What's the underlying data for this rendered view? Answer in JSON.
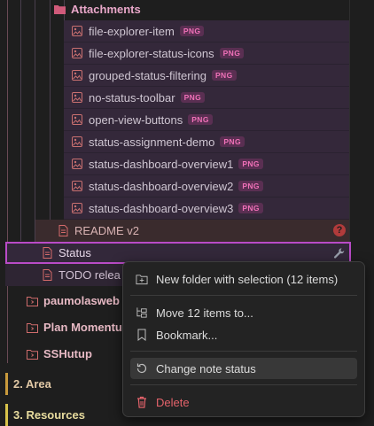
{
  "tree": {
    "attachments_folder": "Attachments",
    "files": [
      {
        "name": "file-explorer-item",
        "ext": "PNG"
      },
      {
        "name": "file-explorer-status-icons",
        "ext": "PNG"
      },
      {
        "name": "grouped-status-filtering",
        "ext": "PNG"
      },
      {
        "name": "no-status-toolbar",
        "ext": "PNG"
      },
      {
        "name": "open-view-buttons",
        "ext": "PNG"
      },
      {
        "name": "status-assignment-demo",
        "ext": "PNG"
      },
      {
        "name": "status-dashboard-overview1",
        "ext": "PNG"
      },
      {
        "name": "status-dashboard-overview2",
        "ext": "PNG"
      },
      {
        "name": "status-dashboard-overview3",
        "ext": "PNG"
      }
    ],
    "readme": "README v2",
    "readme_status_icon": "question-icon",
    "status_note": "Status",
    "status_note_icon": "wrench-icon",
    "todo_note": "TODO relea",
    "folders": [
      "paumolasweb",
      "Plan Momentu",
      "SSHutup"
    ],
    "area": "2. Area",
    "resources": "3. Resources"
  },
  "context_menu": {
    "items": [
      {
        "id": "new-folder",
        "label": "New folder with selection (12 items)",
        "icon": "folder-plus-icon"
      },
      {
        "id": "move",
        "label": "Move 12 items to...",
        "icon": "move-tree-icon"
      },
      {
        "id": "bookmark",
        "label": "Bookmark...",
        "icon": "bookmark-icon"
      },
      {
        "id": "change-status",
        "label": "Change note status",
        "icon": "history-icon",
        "highlighted": true
      },
      {
        "id": "delete",
        "label": "Delete",
        "icon": "trash-icon",
        "danger": true
      }
    ]
  },
  "colors": {
    "selection_bg": "#34283a",
    "accent_border": "#b94bc7",
    "readme_bg": "#3a2b2d",
    "badge_text": "#f071b8",
    "danger": "#e5636b",
    "area_accent": "#c99a3c",
    "resources_accent": "#d8c24a"
  }
}
